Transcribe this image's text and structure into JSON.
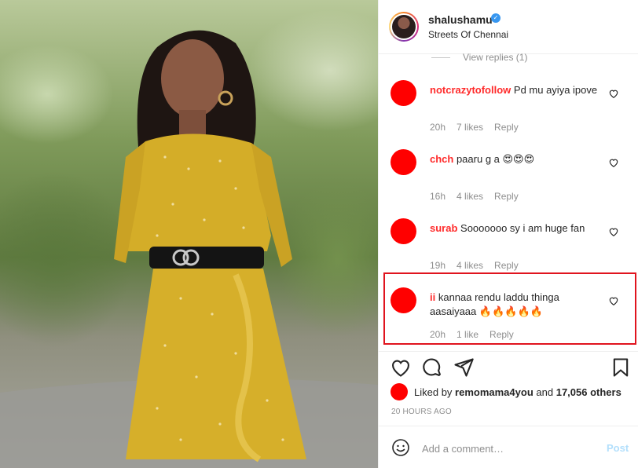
{
  "post": {
    "username": "shalushamu",
    "location": "Streets Of Chennai"
  },
  "view_replies": "View replies (1)",
  "comments": [
    {
      "name": "notcrazytofollow",
      "text": " Pd mu ayiya ipove",
      "time": "20h",
      "likes": "7 likes",
      "reply": "Reply"
    },
    {
      "name": "chch",
      "text": " paaru g a 😍😍😍",
      "time": "16h",
      "likes": "4 likes",
      "reply": "Reply"
    },
    {
      "name": "surab",
      "text": " Sooooooo sy i am huge fan",
      "time": "19h",
      "likes": "4 likes",
      "reply": "Reply"
    },
    {
      "name": "ii",
      "text": " kannaa rendu laddu thinga aasaiyaaa 🔥🔥🔥🔥🔥",
      "time": "20h",
      "likes": "1 like",
      "reply": "Reply"
    }
  ],
  "liked_by": {
    "prefix": "Liked by",
    "user": "remomama4you",
    "and": "and",
    "others": "17,056 others"
  },
  "time_ago": "20 HOURS AGO",
  "comment_box": {
    "placeholder": "Add a comment…",
    "post_label": "Post"
  },
  "colors": {
    "highlight": "#e0141e",
    "redaction": "#ff0000",
    "verified": "#3897f0",
    "post_disabled": "#b2dffc"
  },
  "icons": [
    "verified-badge-icon",
    "heart-icon",
    "comment-icon",
    "share-icon",
    "bookmark-icon",
    "emoji-icon"
  ]
}
